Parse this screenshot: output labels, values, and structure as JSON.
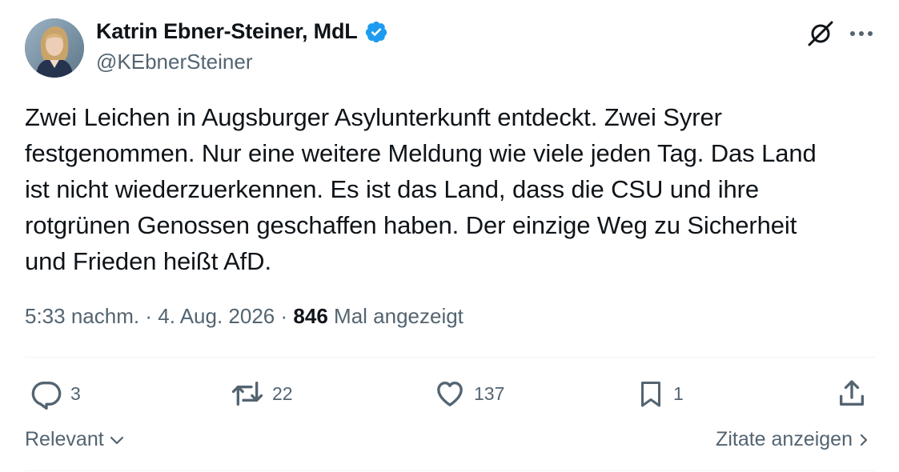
{
  "author": {
    "display_name": "Katrin Ebner-Steiner, MdL",
    "handle": "@KEbnerSteiner"
  },
  "icons": {
    "verified": "verified-badge-icon",
    "grok": "grok-icon",
    "more": "more-icon",
    "reply": "reply-icon",
    "retweet": "retweet-icon",
    "like": "heart-icon",
    "bookmark": "bookmark-icon",
    "share": "share-icon",
    "chevron_down": "chevron-down-icon",
    "chevron_right": "chevron-right-icon"
  },
  "colors": {
    "verified": "#1d9bf0",
    "secondary_text": "#536471",
    "primary_text": "#0f1419",
    "divider": "#eff3f4"
  },
  "tweet": {
    "text": "Zwei Leichen in Augsburger Asylunterkunft entdeckt. Zwei Syrer\nfestgenommen. Nur eine weitere Meldung wie viele jeden Tag. Das Land\nist nicht wiederzuerkennen. Es ist das Land, dass die CSU und ihre\nrotgrünen Genossen geschaffen haben. Der einzige Weg zu Sicherheit\nund Frieden heißt AfD.",
    "time": "5:33 nachm.",
    "separator": "·",
    "date": "4. Aug. 2026",
    "views_count": "846",
    "views_label": "Mal angezeigt"
  },
  "actions": {
    "replies": "3",
    "retweets": "22",
    "likes": "137",
    "bookmarks": "1"
  },
  "footer": {
    "sort_label": "Relevant",
    "quotes_label": "Zitate anzeigen"
  }
}
